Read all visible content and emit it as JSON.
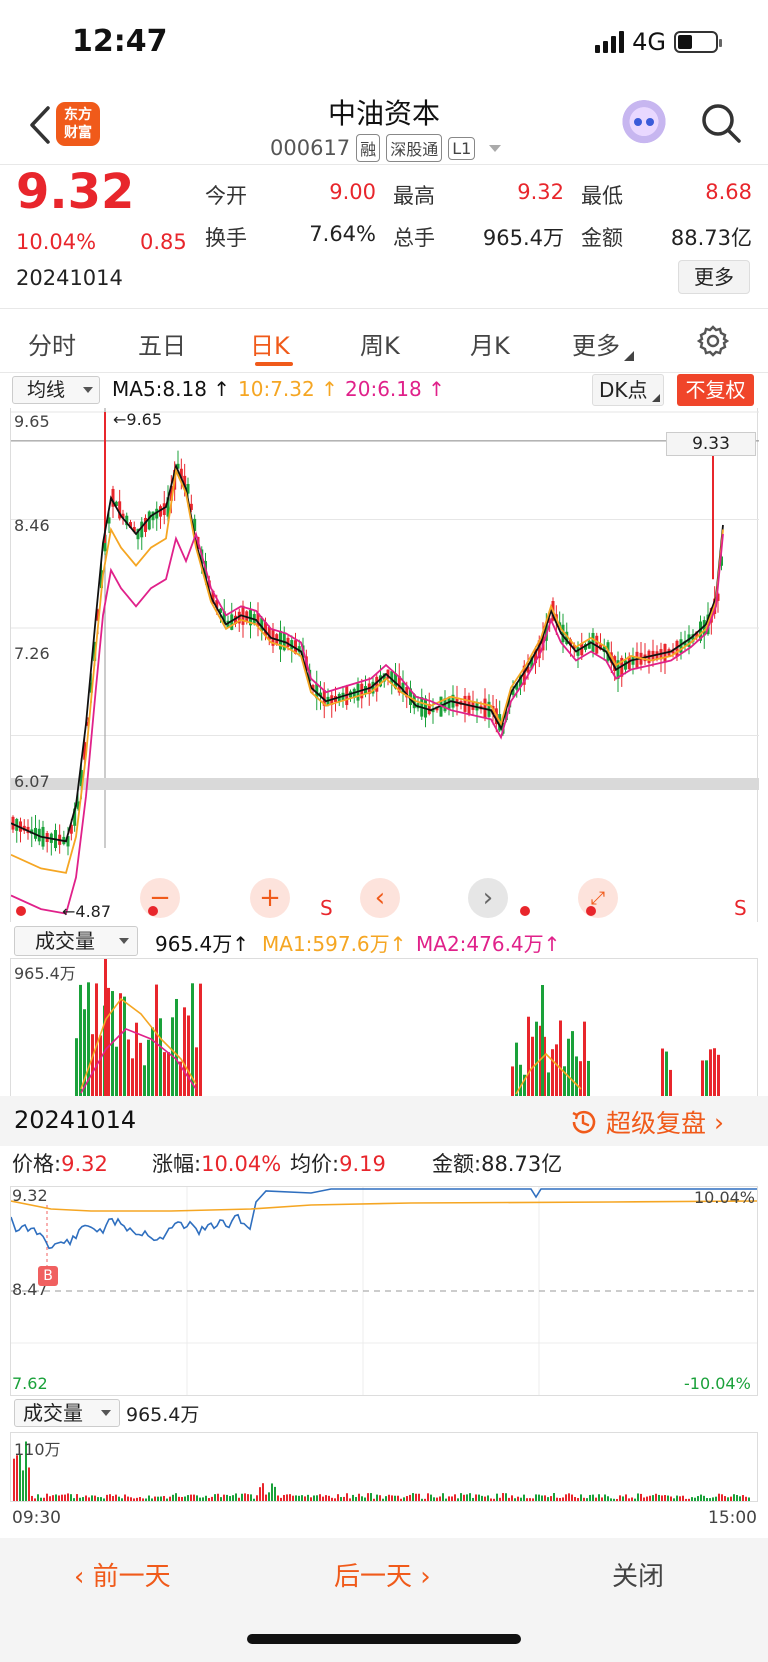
{
  "status": {
    "time": "12:47",
    "network": "4G"
  },
  "header": {
    "brand": "东方财富",
    "title": "中油资本",
    "code": "000617",
    "tags": [
      "融",
      "深股通",
      "L1"
    ]
  },
  "quote": {
    "price": "9.32",
    "pct": "10.04%",
    "change": "0.85",
    "date": "20241014",
    "fields": [
      {
        "label": "今开",
        "value": "9.00"
      },
      {
        "label": "最高",
        "value": "9.32"
      },
      {
        "label": "最低",
        "value": "8.68"
      },
      {
        "label": "换手",
        "value": "7.64%"
      },
      {
        "label": "总手",
        "value": "965.4万"
      },
      {
        "label": "金额",
        "value": "88.73亿"
      }
    ],
    "more": "更多"
  },
  "tabs": [
    "分时",
    "五日",
    "日K",
    "周K",
    "月K",
    "更多"
  ],
  "kline": {
    "indicator_select": "均线",
    "ma5": "MA5:8.18",
    "ma10": "10:7.32",
    "ma20": "20:6.18",
    "dk_button": "DK点",
    "adjust_button": "不复权",
    "y_ticks": [
      "9.65",
      "8.46",
      "7.26",
      "6.07",
      "4.87"
    ],
    "high_marker": "←9.65",
    "low_marker": "←4.87",
    "last_line": "9.33",
    "s_mark": "S",
    "colors": {
      "up": "#e8262c",
      "down": "#1aa13a",
      "ma5": "#111111",
      "ma10": "#f5a623",
      "ma20": "#e0218a"
    }
  },
  "volume": {
    "select": "成交量",
    "value": "965.4万",
    "ma1": "MA1:597.6万",
    "ma2": "MA2:476.4万",
    "max_label": "965.4万"
  },
  "intraday": {
    "date": "20241014",
    "fupan": "超级复盘",
    "labels": {
      "price": "价格:",
      "change": "涨幅:",
      "avg": "均价:",
      "amount": "金额:"
    },
    "values": {
      "price": "9.32",
      "change": "10.04%",
      "avg": "9.19",
      "amount": "88.73亿"
    },
    "y_top": "9.32",
    "y_mid": "8.47",
    "y_bottom": "7.62",
    "pct_top": "10.04%",
    "pct_bottom": "-10.04%",
    "buy_mark": "B",
    "vol_select": "成交量",
    "vol_value": "965.4万",
    "vol_max": "110万",
    "time_start": "09:30",
    "time_end": "15:00"
  },
  "bottom": {
    "prev": "前一天",
    "next": "后一天",
    "close": "关闭"
  }
}
